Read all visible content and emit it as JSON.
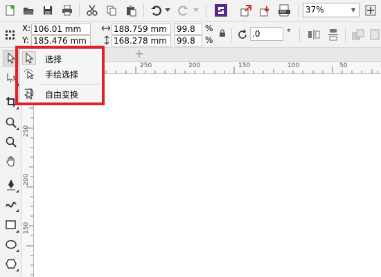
{
  "toolbar": {
    "zoom_value": "37%",
    "icons": [
      "new-document-icon",
      "open-folder-icon",
      "save-icon",
      "print-icon",
      "cut-icon",
      "copy-icon",
      "paste-icon",
      "undo-icon",
      "redo-icon",
      "app-launcher-icon",
      "import-icon",
      "export-icon",
      "publish-pdf-icon",
      "zoom-dropdown-arrow-icon",
      "snap-icon"
    ]
  },
  "property_bar": {
    "x_label": "X:",
    "x_value": "106.01 mm",
    "y_label": "Y:",
    "y_value": "185.476 mm",
    "width_value": "188.759 mm",
    "height_value": "168.278 mm",
    "scale_w": "99.8",
    "scale_h": "99.8",
    "percent": "%",
    "rotation_value": ".0",
    "degree": "°"
  },
  "rulers": {
    "h_ticks": [
      "250",
      "200",
      "150",
      "100",
      "50"
    ],
    "v_ticks": [
      "250",
      "200",
      "150"
    ]
  },
  "flyout": {
    "items": [
      {
        "label": "选择",
        "icon": "pick-arrow-icon"
      },
      {
        "label": "手绘选择",
        "icon": "freehand-pick-icon"
      },
      {
        "label": "自由变换",
        "icon": "free-transform-icon"
      }
    ],
    "highlight_color": "#e0212b"
  }
}
